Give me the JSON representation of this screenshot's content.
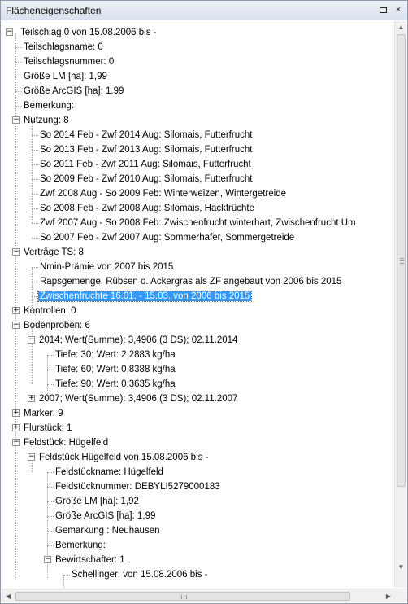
{
  "window": {
    "title": "Flächeneigenschaften",
    "close_glyph": "×"
  },
  "tree": [
    {
      "id": "n0",
      "label": "Teilschlag 0 von 15.08.2006 bis -",
      "toggle": "−"
    },
    {
      "id": "n1",
      "label": "Teilschlagsname: 0"
    },
    {
      "id": "n2",
      "label": "Teilschlagsnummer: 0"
    },
    {
      "id": "n3",
      "label": "Größe LM [ha]: 1,99"
    },
    {
      "id": "n4",
      "label": "Größe ArcGIS [ha]: 1,99"
    },
    {
      "id": "n5",
      "label": "Bemerkung:"
    },
    {
      "id": "n6",
      "label": "Nutzung: 8",
      "toggle": "−"
    },
    {
      "id": "n7",
      "label": "So 2014 Feb - Zwf 2014 Aug: Silomais, Futterfrucht"
    },
    {
      "id": "n8",
      "label": "So 2013 Feb - Zwf 2013 Aug: Silomais, Futterfrucht"
    },
    {
      "id": "n9",
      "label": "So 2011 Feb - Zwf 2011 Aug: Silomais, Futterfrucht"
    },
    {
      "id": "n10",
      "label": "So 2009 Feb - Zwf 2010 Aug: Silomais, Futterfrucht"
    },
    {
      "id": "n11",
      "label": "Zwf 2008 Aug - So 2009 Feb: Winterweizen, Wintergetreide"
    },
    {
      "id": "n12",
      "label": "So 2008 Feb - Zwf 2008 Aug: Silomais, Hackfrüchte"
    },
    {
      "id": "n13",
      "label": "Zwf 2007 Aug - So 2008 Feb: Zwischenfrucht winterhart, Zwischenfrucht Um"
    },
    {
      "id": "n14",
      "label": "So 2007 Feb - Zwf 2007 Aug: Sommerhafer, Sommergetreide"
    },
    {
      "id": "n15",
      "label": "Verträge TS: 8",
      "toggle": "−"
    },
    {
      "id": "n16",
      "label": "Nmin-Prämie von 2007 bis 2015"
    },
    {
      "id": "n17",
      "label": "Rapsgemenge, Rübsen o. Ackergras als ZF angebaut von 2006 bis 2015"
    },
    {
      "id": "n18",
      "label": "Zwischenfruchte 16.01. - 15.03. von 2006 bis 2015",
      "selected": true
    },
    {
      "id": "n19",
      "label": "Kontrollen: 0",
      "toggle": "+"
    },
    {
      "id": "n20",
      "label": "Bodenproben: 6",
      "toggle": "−"
    },
    {
      "id": "n21",
      "label": "2014; Wert(Summe): 3,4906 (3 DS); 02.11.2014",
      "toggle": "−"
    },
    {
      "id": "n22",
      "label": "Tiefe: 30; Wert: 2,2883 kg/ha"
    },
    {
      "id": "n23",
      "label": "Tiefe: 60; Wert: 0,8388 kg/ha"
    },
    {
      "id": "n24",
      "label": "Tiefe: 90; Wert: 0,3635 kg/ha"
    },
    {
      "id": "n25",
      "label": "2007; Wert(Summe): 3,4906 (3 DS); 02.11.2007",
      "toggle": "+"
    },
    {
      "id": "n26",
      "label": "Marker: 9",
      "toggle": "+"
    },
    {
      "id": "n27",
      "label": "Flurstück: 1",
      "toggle": "+"
    },
    {
      "id": "n28",
      "label": "Feldstück: Hügelfeld",
      "toggle": "−"
    },
    {
      "id": "n29",
      "label": "Feldstück Hügelfeld  von 15.08.2006 bis -",
      "toggle": "−"
    },
    {
      "id": "n30",
      "label": "Feldstückname: Hügelfeld"
    },
    {
      "id": "n31",
      "label": "Feldstücknummer: DEBYLI5279000183"
    },
    {
      "id": "n32",
      "label": "Größe LM [ha]: 1,92"
    },
    {
      "id": "n33",
      "label": "Größe ArcGIS [ha]: 1,99"
    },
    {
      "id": "n34",
      "label": "Gemarkung : Neuhausen"
    },
    {
      "id": "n35",
      "label": "Bemerkung:"
    },
    {
      "id": "n36",
      "label": "Bewirtschafter: 1",
      "toggle": "−"
    },
    {
      "id": "n37",
      "label": "Schellinger: von 15.08.2006 bis -"
    }
  ],
  "scrollbars": {
    "up": "▲",
    "down": "▼",
    "left": "◀",
    "right": "▶"
  }
}
